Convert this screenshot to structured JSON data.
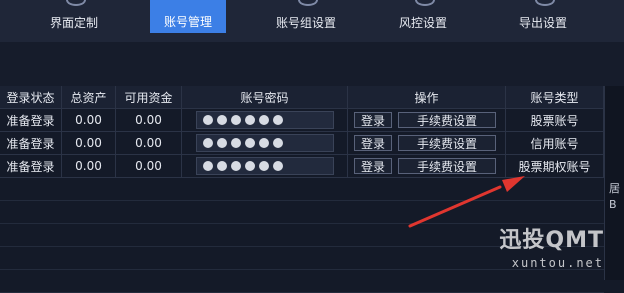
{
  "nav": {
    "items": [
      {
        "label": "界面定制"
      },
      {
        "label": "账号管理"
      },
      {
        "label": "账号组设置"
      },
      {
        "label": "风控设置"
      },
      {
        "label": "导出设置"
      }
    ]
  },
  "table": {
    "headers": [
      "登录状态",
      "总资产",
      "可用资金",
      "账号密码",
      "操作",
      "账号类型"
    ],
    "rows": [
      {
        "status": "准备登录",
        "total": "0.00",
        "available": "0.00",
        "login": "登录",
        "fee": "手续费设置",
        "type": "股票账号"
      },
      {
        "status": "准备登录",
        "total": "0.00",
        "available": "0.00",
        "login": "登录",
        "fee": "手续费设置",
        "type": "信用账号"
      },
      {
        "status": "准备登录",
        "total": "0.00",
        "available": "0.00",
        "login": "登录",
        "fee": "手续费设置",
        "type": "股票期权账号"
      }
    ]
  },
  "right_edge": {
    "top": "居",
    "bottom": "B"
  },
  "watermark": {
    "main": "迅投QMT",
    "sub": "xuntou.net"
  },
  "colors": {
    "accent": "#3c7fe6",
    "arrow": "#e0362f"
  }
}
